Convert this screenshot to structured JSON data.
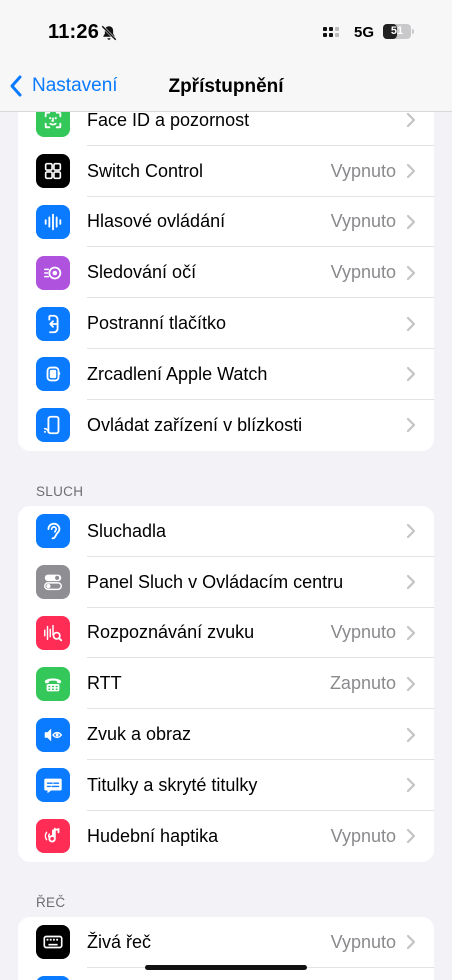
{
  "status_bar": {
    "time": "11:26",
    "network": "5G",
    "battery": "51",
    "battery_level": 0.51
  },
  "nav": {
    "back_label": "Nastavení",
    "title": "Zpřístupnění"
  },
  "group1": {
    "rows": [
      {
        "label": "Face ID a pozornost",
        "value": "",
        "icon": "face-id-icon",
        "color": "#34c759"
      },
      {
        "label": "Switch Control",
        "value": "Vypnuto",
        "icon": "switch-control-icon",
        "color": "#000000"
      },
      {
        "label": "Hlasové ovládání",
        "value": "Vypnuto",
        "icon": "voice-control-icon",
        "color": "#0a7aff"
      },
      {
        "label": "Sledování očí",
        "value": "Vypnuto",
        "icon": "eye-tracking-icon",
        "color": "#af52de"
      },
      {
        "label": "Postranní tlačítko",
        "value": "",
        "icon": "side-button-icon",
        "color": "#0a7aff"
      },
      {
        "label": "Zrcadlení Apple Watch",
        "value": "",
        "icon": "apple-watch-icon",
        "color": "#0a7aff"
      },
      {
        "label": "Ovládat zařízení v blízkosti",
        "value": "",
        "icon": "nearby-devices-icon",
        "color": "#0a7aff"
      }
    ]
  },
  "section_hearing": "SLUCH",
  "group2": {
    "rows": [
      {
        "label": "Sluchadla",
        "value": "",
        "icon": "ear-icon",
        "color": "#0a7aff"
      },
      {
        "label": "Panel Sluch v Ovládacím centru",
        "value": "",
        "icon": "toggle-icon",
        "color": "#8e8e93"
      },
      {
        "label": "Rozpoznávání zvuku",
        "value": "Vypnuto",
        "icon": "sound-recognition-icon",
        "color": "#ff2d55"
      },
      {
        "label": "RTT",
        "value": "Zapnuto",
        "icon": "tty-icon",
        "color": "#34c759"
      },
      {
        "label": "Zvuk a obraz",
        "value": "",
        "icon": "audio-visual-icon",
        "color": "#0a7aff"
      },
      {
        "label": "Titulky a skryté titulky",
        "value": "",
        "icon": "subtitles-icon",
        "color": "#0a7aff"
      },
      {
        "label": "Hudební haptika",
        "value": "Vypnuto",
        "icon": "music-haptics-icon",
        "color": "#ff2d55"
      }
    ]
  },
  "section_speech": "ŘEČ",
  "group3": {
    "rows": [
      {
        "label": "Živá řeč",
        "value": "Vypnuto",
        "icon": "keyboard-icon",
        "color": "#000000"
      },
      {
        "label": "",
        "value": "",
        "icon": "partial-icon",
        "color": "#0a7aff"
      }
    ]
  }
}
